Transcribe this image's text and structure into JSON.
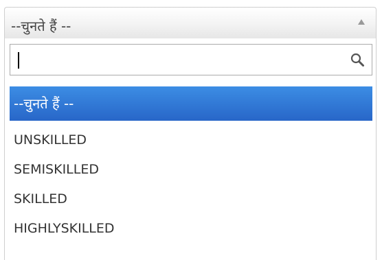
{
  "select": {
    "selected_label": "--चुनते हैं --",
    "arrow_icon": "triangle-up-icon"
  },
  "search": {
    "value": "",
    "placeholder": "",
    "icon": "search-icon"
  },
  "options": [
    {
      "label": "--चुनते हैं --",
      "highlighted": true
    },
    {
      "label": "UNSKILLED",
      "highlighted": false
    },
    {
      "label": "SEMISKILLED",
      "highlighted": false
    },
    {
      "label": "SKILLED",
      "highlighted": false
    },
    {
      "label": "HIGHLYSKILLED",
      "highlighted": false
    }
  ],
  "colors": {
    "highlight": "#3875d7",
    "border": "#aaaaaa"
  }
}
